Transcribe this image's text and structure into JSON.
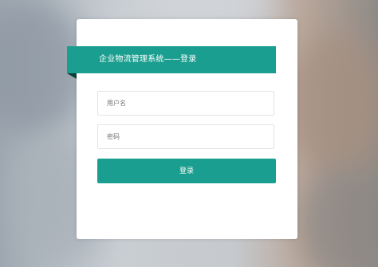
{
  "login": {
    "title": "企业物流管理系统——登录",
    "username_placeholder": "用户名",
    "password_placeholder": "密码",
    "submit_label": "登录"
  },
  "colors": {
    "accent": "#1a9e8f",
    "ribbon_fold": "#0c3d37",
    "card": "#ffffff"
  }
}
